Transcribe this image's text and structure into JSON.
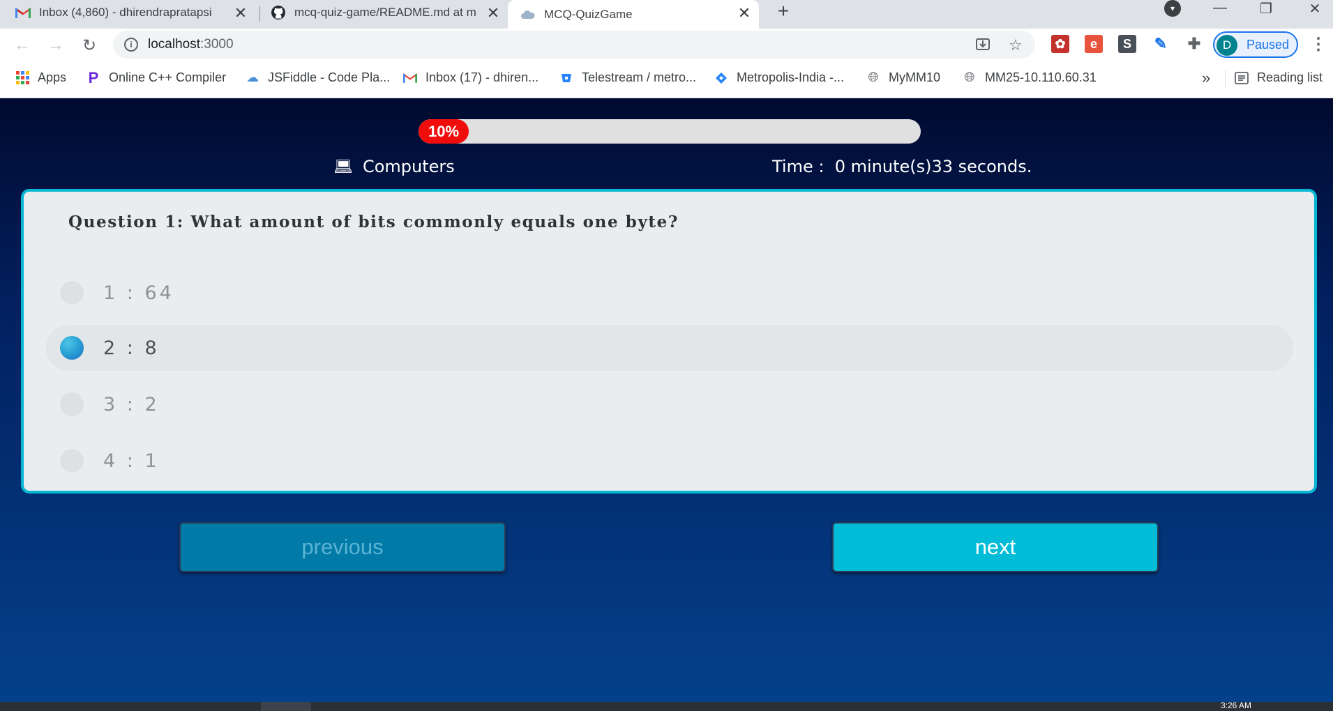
{
  "browser": {
    "tabs": [
      {
        "title": "Inbox (4,860) - dhirendrapratapsi",
        "icon": "gmail-icon",
        "active": false
      },
      {
        "title": "mcq-quiz-game/README.md at m",
        "icon": "github-icon",
        "active": false
      },
      {
        "title": "MCQ-QuizGame",
        "icon": "cloud-favicon-icon",
        "active": true
      }
    ],
    "url_host": "localhost",
    "url_port": ":3000",
    "profile_initial": "D",
    "profile_status": "Paused",
    "bookmarks": [
      {
        "label": "Apps",
        "icon": "apps-grid-icon"
      },
      {
        "label": "Online C++ Compiler",
        "icon": "programiz-icon"
      },
      {
        "label": "JSFiddle - Code Pla...",
        "icon": "jsfiddle-icon"
      },
      {
        "label": "Inbox (17) - dhiren...",
        "icon": "gmail-icon"
      },
      {
        "label": "Telestream / metro...",
        "icon": "bitbucket-icon"
      },
      {
        "label": "Metropolis-India -...",
        "icon": "jira-icon"
      },
      {
        "label": "MyMM10",
        "icon": "globe-icon"
      },
      {
        "label": "MM25-10.110.60.31",
        "icon": "globe-icon"
      }
    ],
    "reading_list": "Reading list",
    "more_chevron": "»"
  },
  "quiz": {
    "progress_label": "10%",
    "progress_fraction": 0.1,
    "category_icon": "laptop-icon",
    "category": "Computers",
    "timer_label": "Time :",
    "timer_value": "0 minute(s)33 seconds.",
    "question": "Question 1: What amount of bits commonly equals one byte?",
    "options": [
      {
        "text": "1 : 64",
        "selected": false
      },
      {
        "text": "2 : 8",
        "selected": true
      },
      {
        "text": "3 : 2",
        "selected": false
      },
      {
        "text": "4 : 1",
        "selected": false
      }
    ],
    "prev_label": "previous",
    "next_label": "next"
  },
  "taskbar": {
    "clock": "3:26 AM"
  },
  "colors": {
    "card_border": "#08b7d4",
    "progress_fill": "#f20d0d",
    "next_button": "#00bcd6",
    "prev_button": "#027aa8",
    "bg_top": "#010a2f",
    "bg_bottom": "#04418a"
  }
}
